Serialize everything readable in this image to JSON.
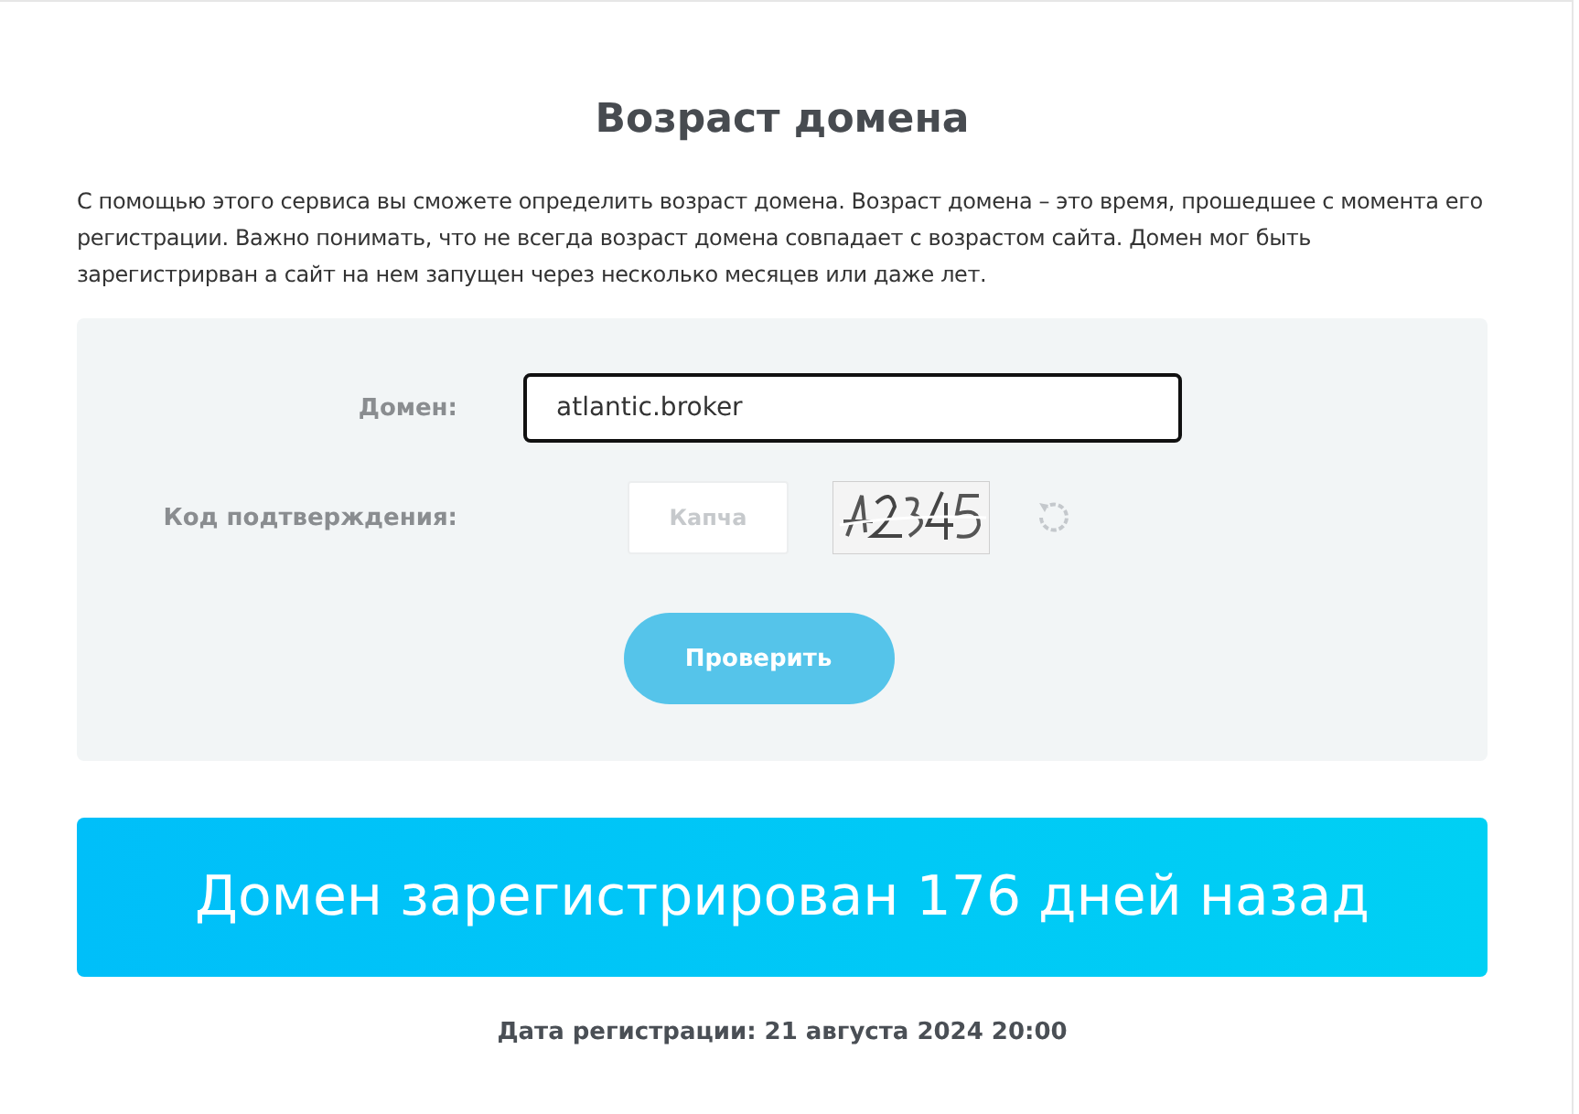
{
  "title": "Возраст домена",
  "description": "С помощью этого сервиса вы сможете определить возраст домена. Возраст домена – это время, прошедшее с момента его регистрации. Важно понимать, что не всегда возраст домена совпадает с возрастом сайта. Домен мог быть зарегистрирван а сайт на нем запущен через несколько месяцев или даже лет.",
  "form": {
    "domain": {
      "label": "Домен:",
      "value": "atlantic.broker",
      "focused": true
    },
    "captcha": {
      "label": "Код подтверждения:",
      "placeholder": "Капча"
    },
    "submit": "Проверить"
  },
  "result": {
    "headline": "Домен зарегистрирован 176 дней назад",
    "date": "Дата регистрации: 21 августа 2024 20:00"
  }
}
